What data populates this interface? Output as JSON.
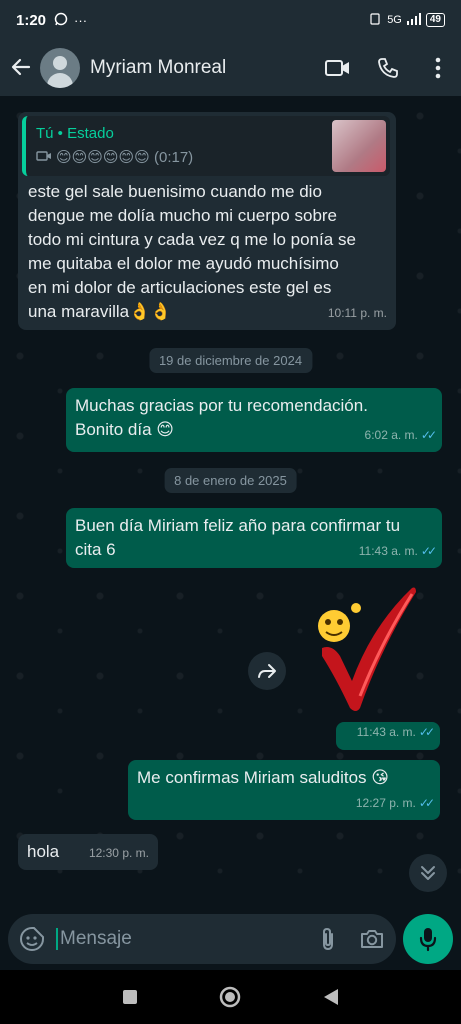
{
  "status_bar": {
    "time": "1:20",
    "network": "5G",
    "battery": "49"
  },
  "header": {
    "contact_name": "Myriam Monreal"
  },
  "messages": {
    "m1": {
      "quote_author": "Tú • Estado",
      "quote_text": "😊😊😊😊😊😊 (0:17)",
      "text": "este gel sale buenisimo  cuando me dio dengue me dolía mucho mi cuerpo sobre todo mi cintura y cada vez q me lo ponía se me quitaba el dolor me ayudó muchísimo en mi dolor de articulaciones este gel es una maravilla👌👌",
      "time": "10:11 p. m."
    },
    "date1": "19 de diciembre de 2024",
    "m2": {
      "text": "Muchas gracias por tu recomendación. Bonito día 😊",
      "time": "6:02 a. m."
    },
    "date2": "8 de enero de 2025",
    "m3": {
      "text": "Buen día Miriam feliz año para confirmar tu cita 6",
      "time": "11:43 a. m."
    },
    "m4": {
      "time": "11:43 a. m."
    },
    "m5": {
      "text": "Me confirmas Miriam saluditos 😘",
      "time": "12:27 p. m."
    },
    "m6": {
      "text": "hola",
      "time": "12:30 p. m."
    }
  },
  "composer": {
    "placeholder": "Mensaje"
  },
  "colors": {
    "accent": "#00a884",
    "outgoing": "#005c4b",
    "incoming": "#1f2c34",
    "read_ticks": "#53bdeb"
  }
}
